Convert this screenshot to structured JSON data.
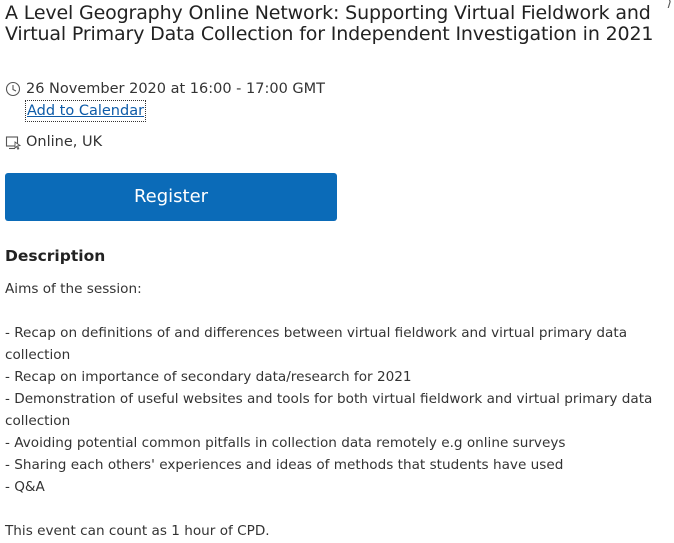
{
  "event": {
    "title": "A Level Geography Online Network: Supporting Virtual Fieldwork and Virtual Primary Data Collection for Independent Investigation in 2021",
    "date_time": "26 November 2020 at 16:00 - 17:00 GMT",
    "add_to_calendar": "Add to Calendar",
    "location": "Online, UK",
    "register_label": "Register"
  },
  "description": {
    "heading": "Description",
    "intro": "Aims of the session:",
    "items": [
      "- Recap on definitions of and differences between virtual fieldwork and virtual primary data collection",
      "- Recap on importance of secondary data/research for 2021",
      "- Demonstration of useful websites and tools for both virtual fieldwork and virtual primary data collection",
      "- Avoiding potential common pitfalls in collection data remotely e.g online surveys",
      "- Sharing each others' experiences and ideas of methods that students have used",
      "- Q&A"
    ],
    "footer": "This event can count as 1 hour of CPD."
  },
  "icons": {
    "date": "clock-icon",
    "location": "online-location-icon"
  },
  "colors": {
    "register_bg": "#0b6bb8",
    "link": "#0d5ba8"
  }
}
